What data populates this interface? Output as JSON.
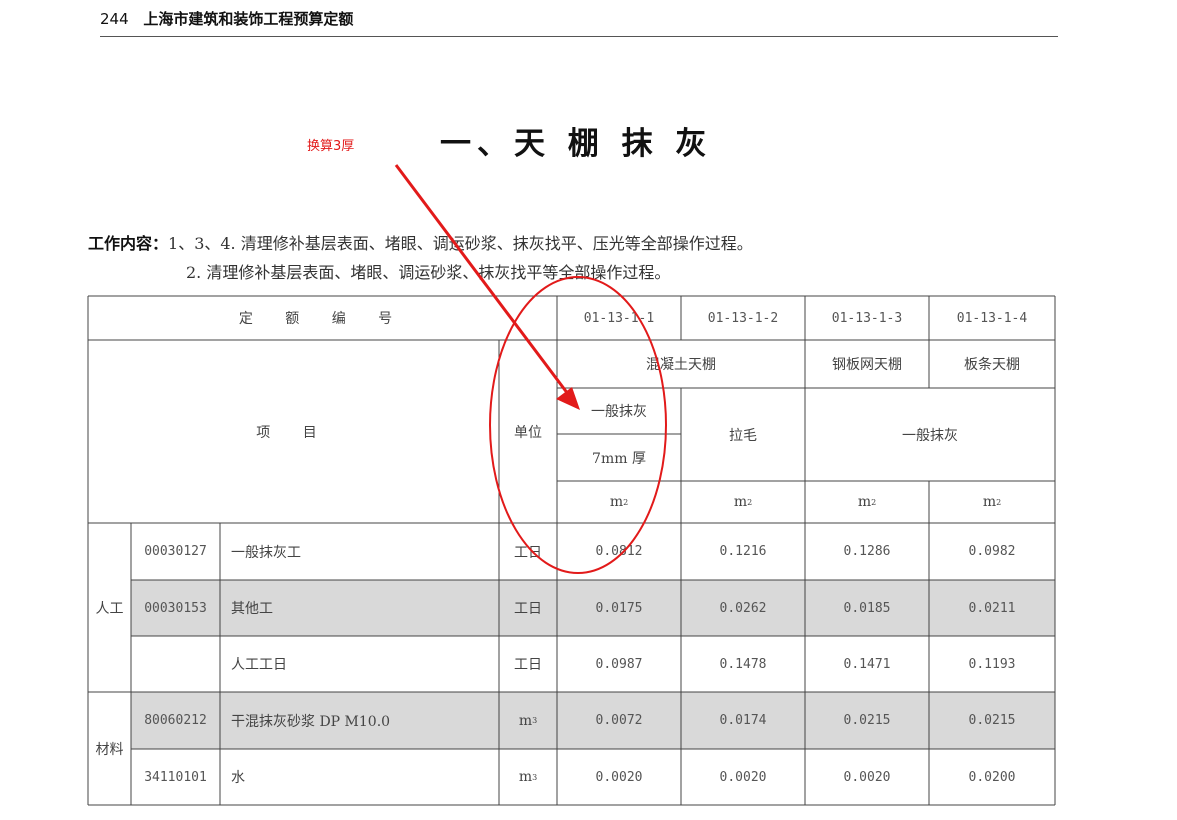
{
  "header": {
    "page_number": "244",
    "book_title": "上海市建筑和装饰工程预算定额"
  },
  "section_title": "一、天 棚 抹 灰",
  "annotation": {
    "label": "换算3厚",
    "color": "#e21a1a"
  },
  "work_content": {
    "label": "工作内容：",
    "line1": "1、3、4. 清理修补基层表面、堵眼、调运砂浆、抹灰找平、压光等全部操作过程。",
    "line2": "2. 清理修补基层表面、堵眼、调运砂浆、抹灰找平等全部操作过程。"
  },
  "table": {
    "quota_label": "定 额 编 号",
    "quota_codes": [
      "01-13-1-1",
      "01-13-1-2",
      "01-13-1-3",
      "01-13-1-4"
    ],
    "item_label": "项 目",
    "unit_label": "单位",
    "group_concrete": "混凝土天棚",
    "group_mesh": "钢板网天棚",
    "group_lath": "板条天棚",
    "general_plaster": "一般抹灰",
    "thickness": "7mm 厚",
    "roughen": "拉毛",
    "general_plaster_merged": "一般抹灰",
    "unit_m": "m",
    "unit_sup": "2",
    "category_labor": "人工",
    "category_material": "材料",
    "rows": [
      {
        "code": "00030127",
        "name": "一般抹灰工",
        "unit": "工日",
        "sup": "",
        "values": [
          "0.0812",
          "0.1216",
          "0.1286",
          "0.0982"
        ]
      },
      {
        "code": "00030153",
        "name": "其他工",
        "unit": "工日",
        "sup": "",
        "values": [
          "0.0175",
          "0.0262",
          "0.0185",
          "0.0211"
        ]
      },
      {
        "code": "",
        "name": "人工工日",
        "unit": "工日",
        "sup": "",
        "values": [
          "0.0987",
          "0.1478",
          "0.1471",
          "0.1193"
        ]
      },
      {
        "code": "80060212",
        "name": "干混抹灰砂浆 DP M10.0",
        "unit": "m",
        "sup": "3",
        "values": [
          "0.0072",
          "0.0174",
          "0.0215",
          "0.0215"
        ]
      },
      {
        "code": "34110101",
        "name": "水",
        "unit": "m",
        "sup": "3",
        "values": [
          "0.0020",
          "0.0020",
          "0.0020",
          "0.0200"
        ]
      }
    ]
  }
}
